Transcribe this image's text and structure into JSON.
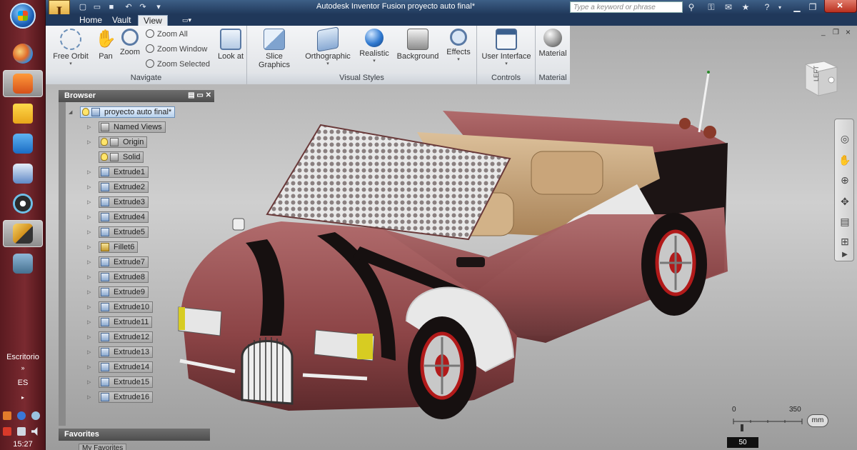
{
  "taskbar": {
    "desktop_label": "Escritorio",
    "language": "ES",
    "clock": "15:27"
  },
  "app": {
    "title": "Autodesk Inventor Fusion    proyecto auto final*",
    "app_button_glyph": "I",
    "search_placeholder": "Type a keyword or phrase"
  },
  "ribbon": {
    "tabs": [
      "Home",
      "Vault",
      "View"
    ],
    "active_tab": "View",
    "navigate": {
      "free_orbit": "Free Orbit",
      "pan": "Pan",
      "zoom": "Zoom",
      "zoom_all": "Zoom All",
      "zoom_window": "Zoom Window",
      "zoom_selected": "Zoom Selected",
      "look_at": "Look at",
      "title": "Navigate"
    },
    "visual_styles": {
      "slice_graphics": "Slice Graphics",
      "orthographic": "Orthographic",
      "realistic": "Realistic",
      "background": "Background",
      "effects": "Effects",
      "title": "Visual Styles"
    },
    "controls": {
      "user_interface": "User Interface",
      "title": "Controls"
    },
    "material": {
      "material": "Material",
      "title": "Material"
    }
  },
  "browser": {
    "title": "Browser",
    "root": "proyecto auto final*",
    "items": [
      {
        "label": "Named Views",
        "kind": "folder"
      },
      {
        "label": "Origin",
        "kind": "folder"
      },
      {
        "label": "Solid",
        "kind": "folder"
      },
      {
        "label": "Extrude1",
        "kind": "feature"
      },
      {
        "label": "Extrude2",
        "kind": "feature"
      },
      {
        "label": "Extrude3",
        "kind": "feature"
      },
      {
        "label": "Extrude4",
        "kind": "feature"
      },
      {
        "label": "Extrude5",
        "kind": "feature"
      },
      {
        "label": "Fillet6",
        "kind": "fillet"
      },
      {
        "label": "Extrude7",
        "kind": "feature"
      },
      {
        "label": "Extrude8",
        "kind": "feature"
      },
      {
        "label": "Extrude9",
        "kind": "feature"
      },
      {
        "label": "Extrude10",
        "kind": "feature"
      },
      {
        "label": "Extrude11",
        "kind": "feature"
      },
      {
        "label": "Extrude12",
        "kind": "feature"
      },
      {
        "label": "Extrude13",
        "kind": "feature"
      },
      {
        "label": "Extrude14",
        "kind": "feature"
      },
      {
        "label": "Extrude15",
        "kind": "feature"
      },
      {
        "label": "Extrude16",
        "kind": "feature"
      }
    ]
  },
  "favorites": {
    "title": "Favorites",
    "item": "My Favorites"
  },
  "viewcube": {
    "face": "LEFT"
  },
  "scale": {
    "min": "0",
    "max": "350",
    "unit": "mm",
    "zoom": "50"
  },
  "colors": {
    "car_body": "#8c4446",
    "car_dark": "#1c1414",
    "car_white": "#e8e8e8",
    "interior": "#c9a57a",
    "titlebar": "#20385a"
  }
}
